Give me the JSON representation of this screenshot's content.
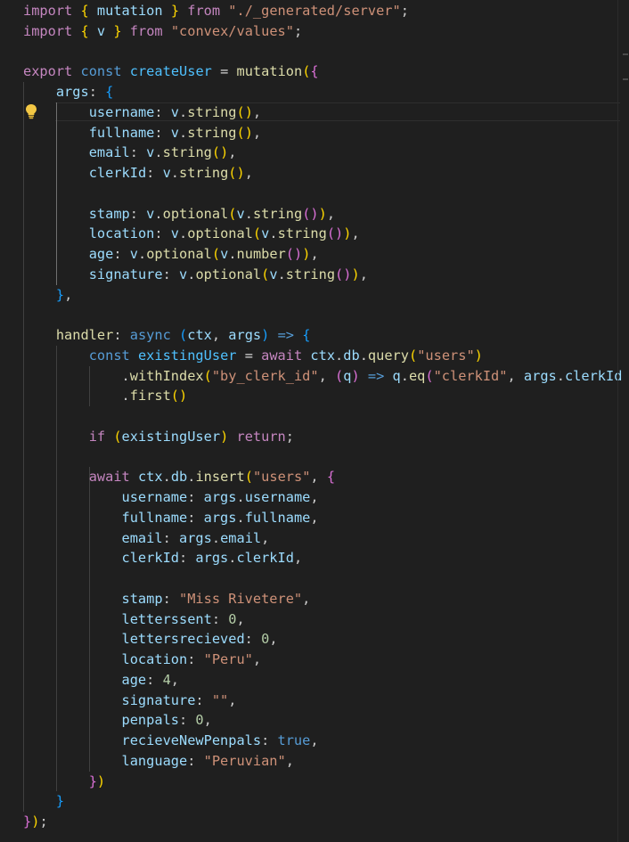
{
  "editor": {
    "language": "typescript",
    "theme": "dark",
    "lines": [
      [
        [
          "import",
          "#c586c0"
        ],
        [
          " ",
          "#cccccc"
        ],
        [
          "{",
          "#ffd700"
        ],
        [
          " mutation ",
          "#9cdcfe"
        ],
        [
          "}",
          "#ffd700"
        ],
        [
          " from ",
          "#c586c0"
        ],
        [
          "\"./_generated/server\"",
          "#ce9178"
        ],
        [
          ";",
          "#cccccc"
        ]
      ],
      [
        [
          "import",
          "#c586c0"
        ],
        [
          " ",
          "#cccccc"
        ],
        [
          "{",
          "#ffd700"
        ],
        [
          " v ",
          "#9cdcfe"
        ],
        [
          "}",
          "#ffd700"
        ],
        [
          " from ",
          "#c586c0"
        ],
        [
          "\"convex/values\"",
          "#ce9178"
        ],
        [
          ";",
          "#cccccc"
        ]
      ],
      [],
      [
        [
          "export",
          "#c586c0"
        ],
        [
          " ",
          "#cccccc"
        ],
        [
          "const",
          "#569cd6"
        ],
        [
          " ",
          "#cccccc"
        ],
        [
          "createUser",
          "#4fc1ff"
        ],
        [
          " = ",
          "#d4d4d4"
        ],
        [
          "mutation",
          "#dcdcaa"
        ],
        [
          "(",
          "#ffd700"
        ],
        [
          "{",
          "#da70d6"
        ]
      ],
      [
        [
          "    ",
          "#cccccc"
        ],
        [
          "args",
          "#9cdcfe"
        ],
        [
          ": ",
          "#cccccc"
        ],
        [
          "{",
          "#179fff"
        ]
      ],
      [
        [
          "        ",
          "#cccccc"
        ],
        [
          "username",
          "#9cdcfe"
        ],
        [
          ": ",
          "#cccccc"
        ],
        [
          "v",
          "#9cdcfe"
        ],
        [
          ".",
          "#cccccc"
        ],
        [
          "string",
          "#dcdcaa"
        ],
        [
          "()",
          "#ffd700"
        ],
        [
          ",",
          "#cccccc"
        ]
      ],
      [
        [
          "        ",
          "#cccccc"
        ],
        [
          "fullname",
          "#9cdcfe"
        ],
        [
          ": ",
          "#cccccc"
        ],
        [
          "v",
          "#9cdcfe"
        ],
        [
          ".",
          "#cccccc"
        ],
        [
          "string",
          "#dcdcaa"
        ],
        [
          "()",
          "#ffd700"
        ],
        [
          ",",
          "#cccccc"
        ]
      ],
      [
        [
          "        ",
          "#cccccc"
        ],
        [
          "email",
          "#9cdcfe"
        ],
        [
          ": ",
          "#cccccc"
        ],
        [
          "v",
          "#9cdcfe"
        ],
        [
          ".",
          "#cccccc"
        ],
        [
          "string",
          "#dcdcaa"
        ],
        [
          "()",
          "#ffd700"
        ],
        [
          ",",
          "#cccccc"
        ]
      ],
      [
        [
          "        ",
          "#cccccc"
        ],
        [
          "clerkId",
          "#9cdcfe"
        ],
        [
          ": ",
          "#cccccc"
        ],
        [
          "v",
          "#9cdcfe"
        ],
        [
          ".",
          "#cccccc"
        ],
        [
          "string",
          "#dcdcaa"
        ],
        [
          "()",
          "#ffd700"
        ],
        [
          ",",
          "#cccccc"
        ]
      ],
      [],
      [
        [
          "        ",
          "#cccccc"
        ],
        [
          "stamp",
          "#9cdcfe"
        ],
        [
          ": ",
          "#cccccc"
        ],
        [
          "v",
          "#9cdcfe"
        ],
        [
          ".",
          "#cccccc"
        ],
        [
          "optional",
          "#dcdcaa"
        ],
        [
          "(",
          "#ffd700"
        ],
        [
          "v",
          "#9cdcfe"
        ],
        [
          ".",
          "#cccccc"
        ],
        [
          "string",
          "#dcdcaa"
        ],
        [
          "()",
          "#da70d6"
        ],
        [
          ")",
          "#ffd700"
        ],
        [
          ",",
          "#cccccc"
        ]
      ],
      [
        [
          "        ",
          "#cccccc"
        ],
        [
          "location",
          "#9cdcfe"
        ],
        [
          ": ",
          "#cccccc"
        ],
        [
          "v",
          "#9cdcfe"
        ],
        [
          ".",
          "#cccccc"
        ],
        [
          "optional",
          "#dcdcaa"
        ],
        [
          "(",
          "#ffd700"
        ],
        [
          "v",
          "#9cdcfe"
        ],
        [
          ".",
          "#cccccc"
        ],
        [
          "string",
          "#dcdcaa"
        ],
        [
          "()",
          "#da70d6"
        ],
        [
          ")",
          "#ffd700"
        ],
        [
          ",",
          "#cccccc"
        ]
      ],
      [
        [
          "        ",
          "#cccccc"
        ],
        [
          "age",
          "#9cdcfe"
        ],
        [
          ": ",
          "#cccccc"
        ],
        [
          "v",
          "#9cdcfe"
        ],
        [
          ".",
          "#cccccc"
        ],
        [
          "optional",
          "#dcdcaa"
        ],
        [
          "(",
          "#ffd700"
        ],
        [
          "v",
          "#9cdcfe"
        ],
        [
          ".",
          "#cccccc"
        ],
        [
          "number",
          "#dcdcaa"
        ],
        [
          "()",
          "#da70d6"
        ],
        [
          ")",
          "#ffd700"
        ],
        [
          ",",
          "#cccccc"
        ]
      ],
      [
        [
          "        ",
          "#cccccc"
        ],
        [
          "signature",
          "#9cdcfe"
        ],
        [
          ": ",
          "#cccccc"
        ],
        [
          "v",
          "#9cdcfe"
        ],
        [
          ".",
          "#cccccc"
        ],
        [
          "optional",
          "#dcdcaa"
        ],
        [
          "(",
          "#ffd700"
        ],
        [
          "v",
          "#9cdcfe"
        ],
        [
          ".",
          "#cccccc"
        ],
        [
          "string",
          "#dcdcaa"
        ],
        [
          "()",
          "#da70d6"
        ],
        [
          ")",
          "#ffd700"
        ],
        [
          ",",
          "#cccccc"
        ]
      ],
      [
        [
          "    ",
          "#cccccc"
        ],
        [
          "}",
          "#179fff"
        ],
        [
          ",",
          "#cccccc"
        ]
      ],
      [],
      [
        [
          "    ",
          "#cccccc"
        ],
        [
          "handler",
          "#dcdcaa"
        ],
        [
          ": ",
          "#cccccc"
        ],
        [
          "async",
          "#569cd6"
        ],
        [
          " ",
          "#cccccc"
        ],
        [
          "(",
          "#179fff"
        ],
        [
          "ctx",
          "#9cdcfe"
        ],
        [
          ", ",
          "#cccccc"
        ],
        [
          "args",
          "#9cdcfe"
        ],
        [
          ")",
          "#179fff"
        ],
        [
          " ",
          "#cccccc"
        ],
        [
          "=>",
          "#569cd6"
        ],
        [
          " ",
          "#cccccc"
        ],
        [
          "{",
          "#179fff"
        ]
      ],
      [
        [
          "        ",
          "#cccccc"
        ],
        [
          "const",
          "#569cd6"
        ],
        [
          " ",
          "#cccccc"
        ],
        [
          "existingUser",
          "#4fc1ff"
        ],
        [
          " = ",
          "#d4d4d4"
        ],
        [
          "await",
          "#c586c0"
        ],
        [
          " ",
          "#cccccc"
        ],
        [
          "ctx",
          "#9cdcfe"
        ],
        [
          ".",
          "#cccccc"
        ],
        [
          "db",
          "#9cdcfe"
        ],
        [
          ".",
          "#cccccc"
        ],
        [
          "query",
          "#dcdcaa"
        ],
        [
          "(",
          "#ffd700"
        ],
        [
          "\"users\"",
          "#ce9178"
        ],
        [
          ")",
          "#ffd700"
        ]
      ],
      [
        [
          "            ",
          "#cccccc"
        ],
        [
          ".",
          "#cccccc"
        ],
        [
          "withIndex",
          "#dcdcaa"
        ],
        [
          "(",
          "#ffd700"
        ],
        [
          "\"by_clerk_id\"",
          "#ce9178"
        ],
        [
          ", ",
          "#cccccc"
        ],
        [
          "(",
          "#da70d6"
        ],
        [
          "q",
          "#9cdcfe"
        ],
        [
          ")",
          "#da70d6"
        ],
        [
          " ",
          "#cccccc"
        ],
        [
          "=>",
          "#569cd6"
        ],
        [
          " ",
          "#cccccc"
        ],
        [
          "q",
          "#9cdcfe"
        ],
        [
          ".",
          "#cccccc"
        ],
        [
          "eq",
          "#dcdcaa"
        ],
        [
          "(",
          "#da70d6"
        ],
        [
          "\"clerkId\"",
          "#ce9178"
        ],
        [
          ", ",
          "#cccccc"
        ],
        [
          "args",
          "#9cdcfe"
        ],
        [
          ".",
          "#cccccc"
        ],
        [
          "clerkId",
          "#9cdcfe"
        ]
      ],
      [
        [
          "            ",
          "#cccccc"
        ],
        [
          ".",
          "#cccccc"
        ],
        [
          "first",
          "#dcdcaa"
        ],
        [
          "()",
          "#ffd700"
        ]
      ],
      [],
      [
        [
          "        ",
          "#cccccc"
        ],
        [
          "if",
          "#c586c0"
        ],
        [
          " ",
          "#cccccc"
        ],
        [
          "(",
          "#ffd700"
        ],
        [
          "existingUser",
          "#9cdcfe"
        ],
        [
          ")",
          "#ffd700"
        ],
        [
          " ",
          "#cccccc"
        ],
        [
          "return",
          "#c586c0"
        ],
        [
          ";",
          "#cccccc"
        ]
      ],
      [],
      [
        [
          "        ",
          "#cccccc"
        ],
        [
          "await",
          "#c586c0"
        ],
        [
          " ",
          "#cccccc"
        ],
        [
          "ctx",
          "#9cdcfe"
        ],
        [
          ".",
          "#cccccc"
        ],
        [
          "db",
          "#9cdcfe"
        ],
        [
          ".",
          "#cccccc"
        ],
        [
          "insert",
          "#dcdcaa"
        ],
        [
          "(",
          "#ffd700"
        ],
        [
          "\"users\"",
          "#ce9178"
        ],
        [
          ", ",
          "#cccccc"
        ],
        [
          "{",
          "#da70d6"
        ]
      ],
      [
        [
          "            ",
          "#cccccc"
        ],
        [
          "username",
          "#9cdcfe"
        ],
        [
          ": ",
          "#cccccc"
        ],
        [
          "args",
          "#9cdcfe"
        ],
        [
          ".",
          "#cccccc"
        ],
        [
          "username",
          "#9cdcfe"
        ],
        [
          ",",
          "#cccccc"
        ]
      ],
      [
        [
          "            ",
          "#cccccc"
        ],
        [
          "fullname",
          "#9cdcfe"
        ],
        [
          ": ",
          "#cccccc"
        ],
        [
          "args",
          "#9cdcfe"
        ],
        [
          ".",
          "#cccccc"
        ],
        [
          "fullname",
          "#9cdcfe"
        ],
        [
          ",",
          "#cccccc"
        ]
      ],
      [
        [
          "            ",
          "#cccccc"
        ],
        [
          "email",
          "#9cdcfe"
        ],
        [
          ": ",
          "#cccccc"
        ],
        [
          "args",
          "#9cdcfe"
        ],
        [
          ".",
          "#cccccc"
        ],
        [
          "email",
          "#9cdcfe"
        ],
        [
          ",",
          "#cccccc"
        ]
      ],
      [
        [
          "            ",
          "#cccccc"
        ],
        [
          "clerkId",
          "#9cdcfe"
        ],
        [
          ": ",
          "#cccccc"
        ],
        [
          "args",
          "#9cdcfe"
        ],
        [
          ".",
          "#cccccc"
        ],
        [
          "clerkId",
          "#9cdcfe"
        ],
        [
          ",",
          "#cccccc"
        ]
      ],
      [],
      [
        [
          "            ",
          "#cccccc"
        ],
        [
          "stamp",
          "#9cdcfe"
        ],
        [
          ": ",
          "#cccccc"
        ],
        [
          "\"Miss Rivetere\"",
          "#ce9178"
        ],
        [
          ",",
          "#cccccc"
        ]
      ],
      [
        [
          "            ",
          "#cccccc"
        ],
        [
          "letterssent",
          "#9cdcfe"
        ],
        [
          ": ",
          "#cccccc"
        ],
        [
          "0",
          "#b5cea8"
        ],
        [
          ",",
          "#cccccc"
        ]
      ],
      [
        [
          "            ",
          "#cccccc"
        ],
        [
          "lettersrecieved",
          "#9cdcfe"
        ],
        [
          ": ",
          "#cccccc"
        ],
        [
          "0",
          "#b5cea8"
        ],
        [
          ",",
          "#cccccc"
        ]
      ],
      [
        [
          "            ",
          "#cccccc"
        ],
        [
          "location",
          "#9cdcfe"
        ],
        [
          ": ",
          "#cccccc"
        ],
        [
          "\"Peru\"",
          "#ce9178"
        ],
        [
          ",",
          "#cccccc"
        ]
      ],
      [
        [
          "            ",
          "#cccccc"
        ],
        [
          "age",
          "#9cdcfe"
        ],
        [
          ": ",
          "#cccccc"
        ],
        [
          "4",
          "#b5cea8"
        ],
        [
          ",",
          "#cccccc"
        ]
      ],
      [
        [
          "            ",
          "#cccccc"
        ],
        [
          "signature",
          "#9cdcfe"
        ],
        [
          ": ",
          "#cccccc"
        ],
        [
          "\"\"",
          "#ce9178"
        ],
        [
          ",",
          "#cccccc"
        ]
      ],
      [
        [
          "            ",
          "#cccccc"
        ],
        [
          "penpals",
          "#9cdcfe"
        ],
        [
          ": ",
          "#cccccc"
        ],
        [
          "0",
          "#b5cea8"
        ],
        [
          ",",
          "#cccccc"
        ]
      ],
      [
        [
          "            ",
          "#cccccc"
        ],
        [
          "recieveNewPenpals",
          "#9cdcfe"
        ],
        [
          ": ",
          "#cccccc"
        ],
        [
          "true",
          "#569cd6"
        ],
        [
          ",",
          "#cccccc"
        ]
      ],
      [
        [
          "            ",
          "#cccccc"
        ],
        [
          "language",
          "#9cdcfe"
        ],
        [
          ": ",
          "#cccccc"
        ],
        [
          "\"Peruvian\"",
          "#ce9178"
        ],
        [
          ",",
          "#cccccc"
        ]
      ],
      [
        [
          "        ",
          "#cccccc"
        ],
        [
          "}",
          "#da70d6"
        ],
        [
          ")",
          "#ffd700"
        ]
      ],
      [
        [
          "    ",
          "#cccccc"
        ],
        [
          "}",
          "#179fff"
        ]
      ],
      [
        [
          "}",
          "#da70d6"
        ],
        [
          ")",
          "#ffd700"
        ],
        [
          ";",
          "#cccccc"
        ]
      ]
    ],
    "gutter_icon": "lightbulb-icon"
  }
}
